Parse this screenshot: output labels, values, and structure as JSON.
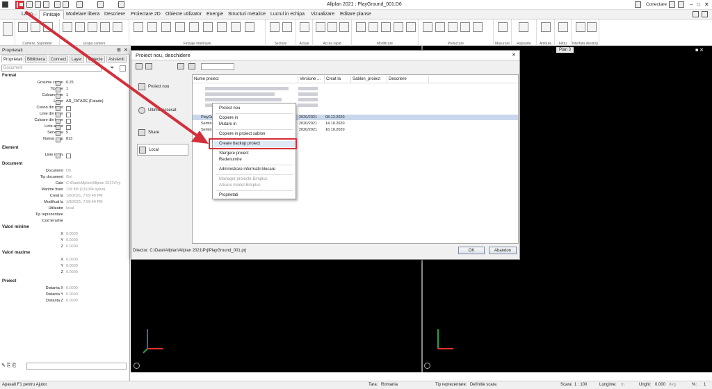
{
  "app": {
    "title": "Allplan 2021 : PlayGround_001:D6",
    "connect_label": "Conectare"
  },
  "tabs": [
    "La ro...",
    "Finisaje",
    "Modelare libera",
    "Descriere",
    "Proiectare 2D",
    "Obiecte utilizator",
    "Energie",
    "Structuri metalice",
    "Lucrul in echipa",
    "Vizualizare",
    "Editare planse"
  ],
  "ribbon_groups": [
    "Camere, Suprafete",
    "Grupa camere",
    "Finisaje interioare",
    "Sectiuni",
    "Actual",
    "Acces rapid",
    "Modificare",
    "Prelucrare",
    "Masurare",
    "Rapoarte",
    "Atribute",
    "Filtru",
    "Interfata desktop"
  ],
  "plan_tooltip": "Plan 3",
  "panel": {
    "title": "Proprietati",
    "tabs": [
      "Proprietati",
      "Biblioteca",
      "Connect",
      "Layer",
      "Obiecte",
      "Asistenti"
    ],
    "doc_select": "Document",
    "sections": {
      "format": "Format",
      "element": "Element",
      "document": "Document",
      "minv": "Valori minime",
      "maxv": "Valori maxime",
      "proiect": "Proiect"
    },
    "format_rows": [
      {
        "label": "Grosime creion",
        "value": "0.25"
      },
      {
        "label": "Tip linie",
        "value": "1"
      },
      {
        "label": "Culoare linie",
        "value": "1"
      },
      {
        "label": "Layer",
        "value": "AR_FATADE (Fatade)"
      },
      {
        "label": "Creion din layer",
        "value": ""
      },
      {
        "label": "Linie din layer",
        "value": ""
      },
      {
        "label": "Culoare din layer",
        "value": ""
      },
      {
        "label": "Linie ajutor",
        "value": ""
      },
      {
        "label": "Secventa",
        "value": "5"
      },
      {
        "label": "Numar grup",
        "value": "813"
      }
    ],
    "element_rows": [
      {
        "label": "Linie motiv",
        "value": ""
      }
    ],
    "document_rows": [
      {
        "label": "Document",
        "value": "D6"
      },
      {
        "label": "Tip document",
        "value": "Gol"
      },
      {
        "label": "Cale",
        "value": "C:\\Date\\Allplan\\Allplan 2021\\Prj\\"
      },
      {
        "label": "Marime fisier",
        "value": "128 KB (131094 bytes)"
      },
      {
        "label": "Creat la",
        "value": "1/8/2021, 7:09:40 PM"
      },
      {
        "label": "Modificat la",
        "value": "1/8/2021, 7:09:40 PM"
      },
      {
        "label": "Utilizator",
        "value": "local"
      },
      {
        "label": "Tip reprezentare",
        "value": ""
      },
      {
        "label": "Cod terarhie",
        "value": ""
      }
    ],
    "xyz": [
      {
        "label": "X",
        "value": "0.0000"
      },
      {
        "label": "Y",
        "value": "0.0000"
      },
      {
        "label": "Z",
        "value": "0.0000"
      }
    ],
    "proiect_rows": [
      {
        "label": "Distanta X",
        "value": "0.0000"
      },
      {
        "label": "Distanta Y",
        "value": "0.0000"
      },
      {
        "label": "Distanta Z",
        "value": "0.0000"
      }
    ]
  },
  "dialog": {
    "title": "Proiect nou, deschidere",
    "nav": [
      "Proiect nou",
      "Ultimul accesat",
      "Share",
      "Local"
    ],
    "columns": [
      "Nume proiect",
      "Versiune ...",
      "Creat la",
      "Sablon_proiect",
      "Descriere"
    ],
    "rows": [
      {
        "name": "PlayGround_001",
        "version": "2020/2021",
        "created": "08.12.2020"
      },
      {
        "name": "Semina...",
        "version": "2020/2021",
        "created": "14.10.2020"
      },
      {
        "name": "Semina...",
        "version": "2020/2021",
        "created": "16.10.2020"
      }
    ],
    "director": "Director: C:\\Date\\Allplan\\Allplan 2021\\Prj\\PlayGround_001.prj",
    "ok": "OK",
    "cancel": "Abandon"
  },
  "context_menu": [
    "Proiect nou",
    "Copiere in",
    "Mutare in",
    "Copiere in proiect sablon",
    "Creare backup proiect",
    "Stergere proiect",
    "Redenumire",
    "Administrare informatii blocare",
    "Manager proiecte Bimplus",
    "Afisare model Bimplus",
    "Proprietati"
  ],
  "status": {
    "help": "Apasati F1 pentru Ajutor.",
    "tara_label": "Tara:",
    "tara": "Romania",
    "tip_label": "Tip reprezentare:",
    "tip": "Definitie scara",
    "scara_label": "Scara:",
    "scara": "1 : 100",
    "lung_label": "Lungime:",
    "lung": "m",
    "unghi_label": "Unghi:",
    "unghi": "0.000",
    "unghi_unit": "deg",
    "pct_label": "%:",
    "pct": "1"
  },
  "colors": {
    "accent": "#d32f3a",
    "viewport": "#000000"
  }
}
